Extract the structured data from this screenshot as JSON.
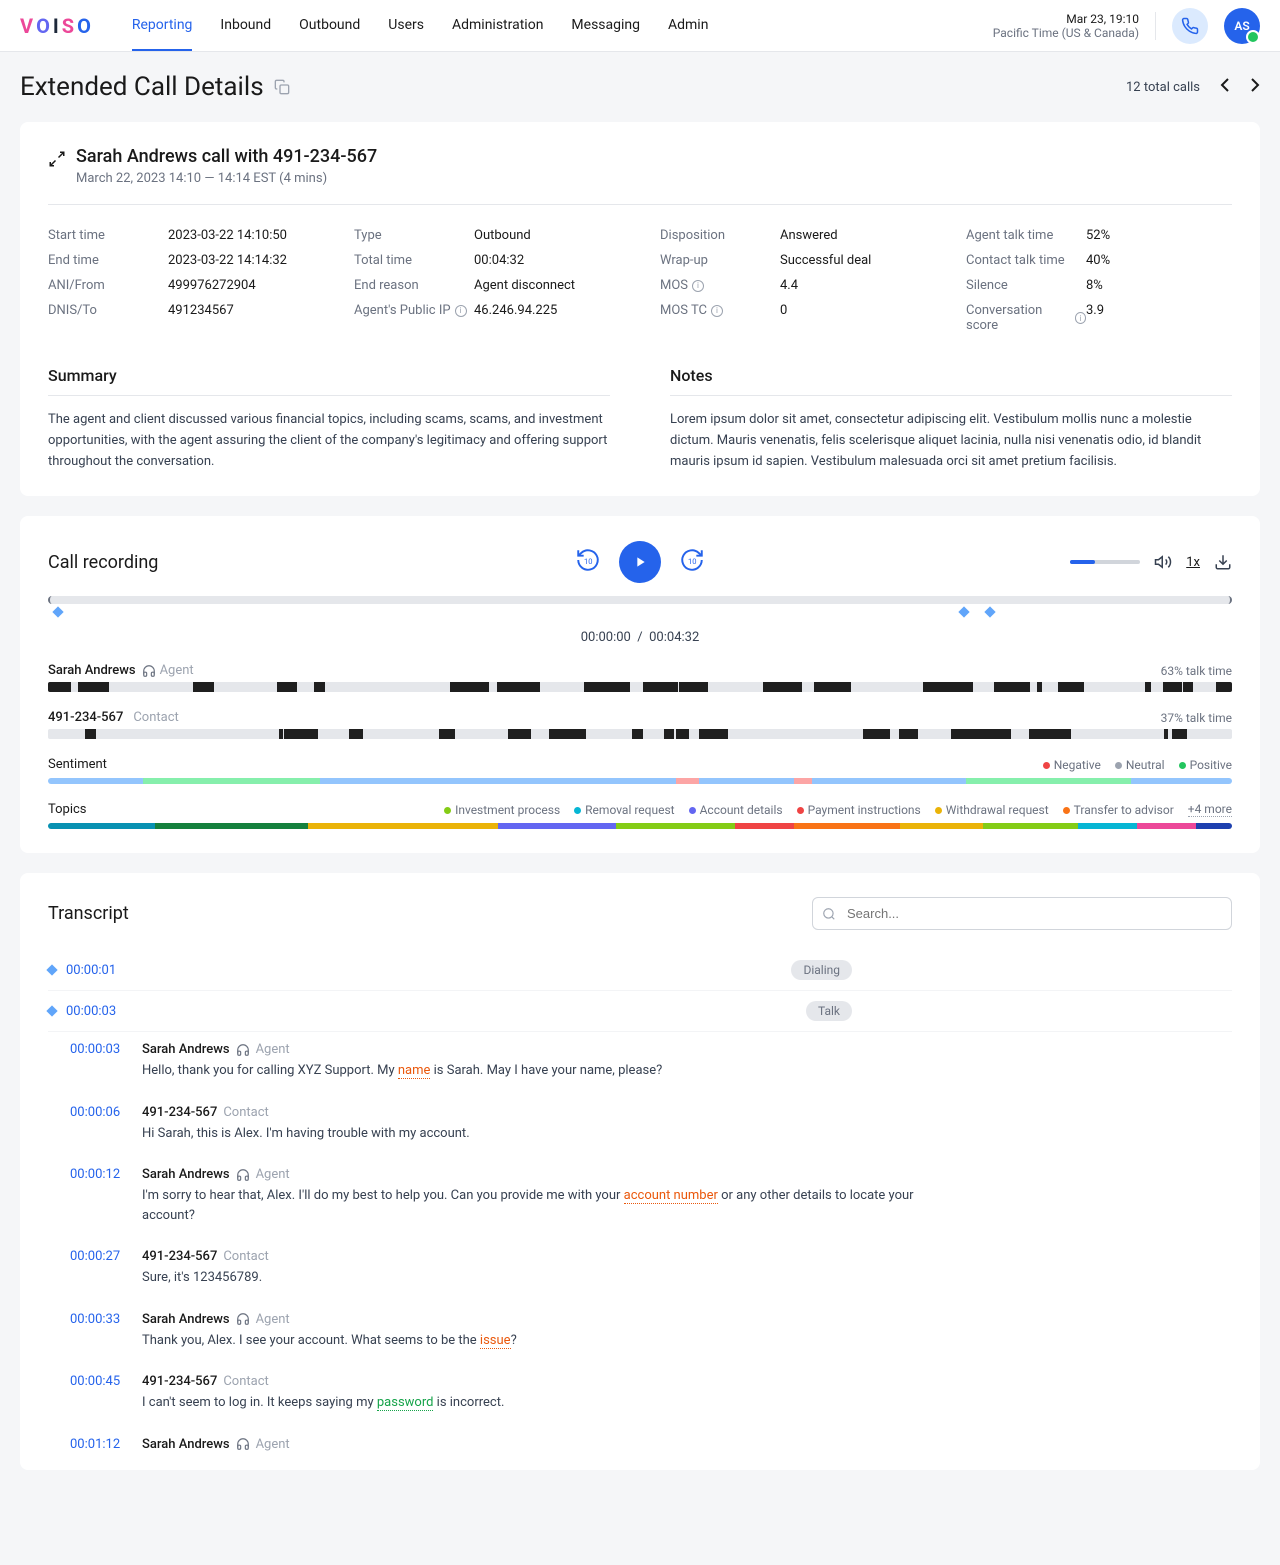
{
  "header": {
    "date": "Mar 23, 19:10",
    "tz": "Pacific Time (US & Canada)",
    "avatar": "AS",
    "nav": [
      "Reporting",
      "Inbound",
      "Outbound",
      "Users",
      "Administration",
      "Messaging",
      "Admin"
    ]
  },
  "page": {
    "title": "Extended Call Details",
    "total": "12 total calls"
  },
  "call": {
    "title": "Sarah Andrews call with 491-234-567",
    "subtitle": "March 22, 2023  14:10 — 14:14 EST (4 mins)"
  },
  "meta": {
    "c1": [
      {
        "label": "Start time",
        "value": "2023-03-22   14:10:50"
      },
      {
        "label": "End time",
        "value": "2023-03-22   14:14:32"
      },
      {
        "label": "ANI/From",
        "value": "499976272904"
      },
      {
        "label": "DNIS/To",
        "value": "491234567"
      }
    ],
    "c2": [
      {
        "label": "Type",
        "value": "Outbound"
      },
      {
        "label": "Total time",
        "value": "00:04:32"
      },
      {
        "label": "End reason",
        "value": "Agent disconnect"
      },
      {
        "label": "Agent's Public IP",
        "value": "46.246.94.225",
        "info": true
      }
    ],
    "c3": [
      {
        "label": "Disposition",
        "value": "Answered"
      },
      {
        "label": "Wrap-up",
        "value": "Successful deal"
      },
      {
        "label": "MOS",
        "value": "4.4",
        "info": true
      },
      {
        "label": "MOS TC",
        "value": "0",
        "info": true
      }
    ],
    "c4": [
      {
        "label": "Agent talk time",
        "value": "52%"
      },
      {
        "label": "Contact talk time",
        "value": "40%"
      },
      {
        "label": "Silence",
        "value": "8%"
      },
      {
        "label": "Conversation score",
        "value": "3.9",
        "info": true
      }
    ]
  },
  "summary": {
    "title": "Summary",
    "body": "The agent and client discussed various financial topics, including scams, scams, and investment opportunities, with the agent assuring the client of the company's legitimacy and offering support throughout the conversation."
  },
  "notes": {
    "title": "Notes",
    "body": "Lorem ipsum dolor sit amet, consectetur adipiscing elit. Vestibulum mollis nunc a molestie dictum. Mauris venenatis, felis scelerisque aliquet lacinia, nulla nisi venenatis odio, id blandit mauris ipsum id sapien. Vestibulum malesuada orci sit amet pretium facilisis."
  },
  "recording": {
    "title": "Call recording",
    "current": "00:00:00",
    "total": "00:04:32",
    "speed": "1x",
    "agent": {
      "name": "Sarah Andrews",
      "role": "Agent",
      "pct": "63% talk time"
    },
    "contact": {
      "name": "491-234-567",
      "role": "Contact",
      "pct": "37% talk time"
    },
    "sentiment_label": "Sentiment",
    "sentiment_legend": [
      {
        "label": "Negative",
        "color": "#ef4444"
      },
      {
        "label": "Neutral",
        "color": "#9ca3af"
      },
      {
        "label": "Positive",
        "color": "#22c55e"
      }
    ],
    "topics_label": "Topics",
    "topics": [
      {
        "label": "Investment process",
        "color": "#84cc16"
      },
      {
        "label": "Removal request",
        "color": "#06b6d4"
      },
      {
        "label": "Account details",
        "color": "#6366f1"
      },
      {
        "label": "Payment instructions",
        "color": "#ef4444"
      },
      {
        "label": "Withdrawal request",
        "color": "#eab308"
      },
      {
        "label": "Transfer to advisor",
        "color": "#f97316"
      }
    ],
    "topics_more": "+4 more"
  },
  "transcript": {
    "title": "Transcript",
    "search_placeholder": "Search...",
    "events": [
      {
        "time": "00:00:01",
        "badge": "Dialing"
      },
      {
        "time": "00:00:03",
        "badge": "Talk"
      }
    ],
    "lines": [
      {
        "time": "00:00:03",
        "speaker": "Sarah Andrews",
        "role": "Agent",
        "agent": true,
        "text": "Hello, thank you for calling XYZ Support. My <hl-orange>name</hl-orange> is Sarah. May I have your name, please?"
      },
      {
        "time": "00:00:06",
        "speaker": "491-234-567",
        "role": "Contact",
        "agent": false,
        "text": "Hi Sarah, this is Alex. I'm having trouble with my account."
      },
      {
        "time": "00:00:12",
        "speaker": "Sarah Andrews",
        "role": "Agent",
        "agent": true,
        "text": "I'm sorry to hear that, Alex. I'll do my best to help you. Can you provide me with your <hl-orange>account number</hl-orange> or any other details to locate your account?"
      },
      {
        "time": "00:00:27",
        "speaker": "491-234-567",
        "role": "Contact",
        "agent": false,
        "text": "Sure, it's 123456789."
      },
      {
        "time": "00:00:33",
        "speaker": "Sarah Andrews",
        "role": "Agent",
        "agent": true,
        "text": "Thank you, Alex. I see your account. What seems to be the <hl-orange>issue</hl-orange>?"
      },
      {
        "time": "00:00:45",
        "speaker": "491-234-567",
        "role": "Contact",
        "agent": false,
        "text": "I can't seem to log in. It keeps saying my <hl-green>password</hl-green> is incorrect."
      },
      {
        "time": "00:01:12",
        "speaker": "Sarah Andrews",
        "role": "Agent",
        "agent": true,
        "text": ""
      }
    ]
  }
}
